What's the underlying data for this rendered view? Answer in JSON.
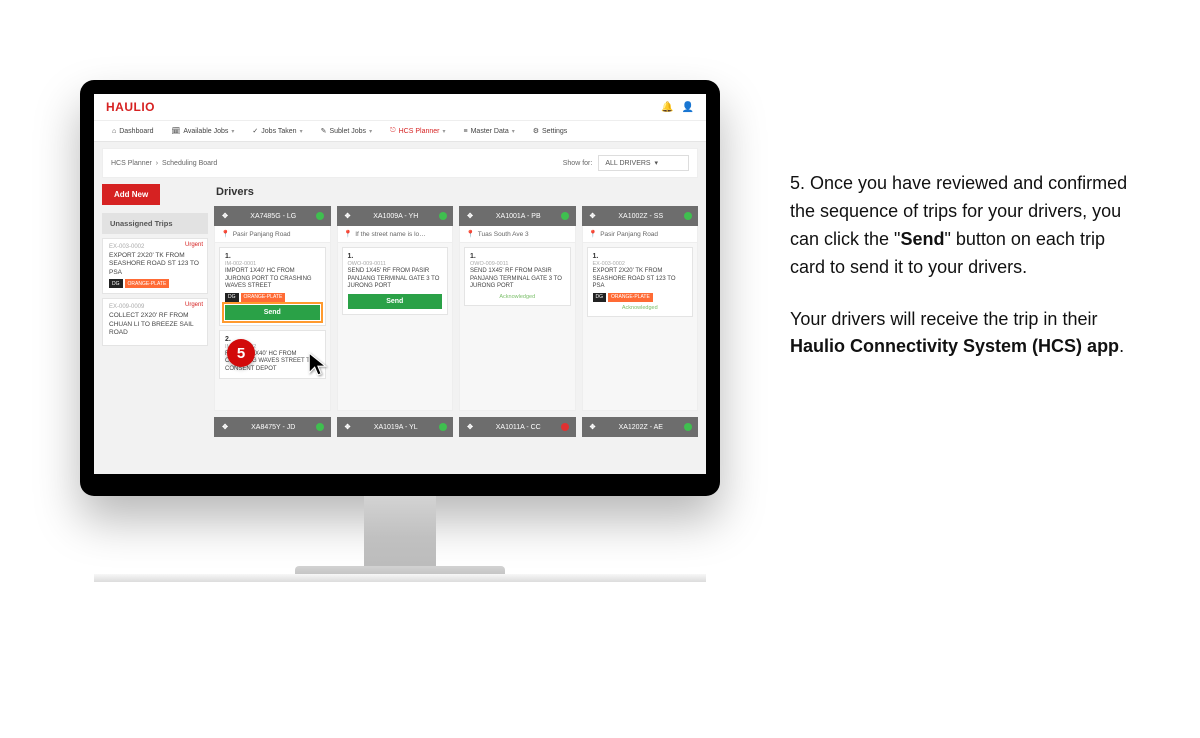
{
  "brand": "HAULIO",
  "nav": {
    "dashboard": "Dashboard",
    "available": "Available Jobs",
    "taken": "Jobs Taken",
    "sublet": "Sublet Jobs",
    "planner": "HCS Planner",
    "master": "Master Data",
    "settings": "Settings"
  },
  "breadcrumb": {
    "a": "HCS Planner",
    "b": "Scheduling Board"
  },
  "showfor": {
    "label": "Show for:",
    "value": "ALL DRIVERS"
  },
  "addnew": "Add New",
  "drivers_title": "Drivers",
  "unassigned": {
    "title": "Unassigned Trips"
  },
  "side_cards": [
    {
      "ref": "EX-003-0002",
      "urgent": "Urgent",
      "desc": "EXPORT 2X20' TK FROM SEASHORE ROAD ST 123 TO PSA",
      "dg": "DG",
      "op": "ORANGE-PLATE"
    },
    {
      "ref": "EX-009-0009",
      "urgent": "Urgent",
      "desc": "COLLECT 2X20' RF FROM CHUAN LI TO BREEZE SAIL ROAD"
    }
  ],
  "columns": [
    {
      "id": "XA7485G - LG",
      "sub": "Pasir Panjang Road",
      "dot": "green",
      "trips": [
        {
          "num": "1.",
          "ref": "IM-002-0001",
          "desc": "IMPORT 1X40' HC FROM JURONG PORT TO CRASHING WAVES STREET",
          "dg": "DG",
          "op": "ORANGE-PLATE",
          "send": "Send",
          "hl": true
        },
        {
          "num": "2.",
          "ref": "IM-002-0002",
          "desc": "RETURN 1X40' HC FROM CRASHING WAVES STREET TO CONSENT DEPOT"
        }
      ]
    },
    {
      "id": "XA1009A - YH",
      "sub": "If the street name is lo…",
      "dot": "green",
      "trips": [
        {
          "num": "1.",
          "ref": "OWO-009-0011",
          "desc": "SEND 1X45' RF FROM PASIR PANJANG TERMINAL GATE 3 TO JURONG PORT",
          "send": "Send"
        }
      ]
    },
    {
      "id": "XA1001A - PB",
      "sub": "Tuas South Ave 3",
      "dot": "green",
      "trips": [
        {
          "num": "1.",
          "ref": "OWO-009-0011",
          "desc": "SEND 1X45' RF FROM PASIR PANJANG TERMINAL GATE 3 TO JURONG PORT",
          "ack": "Acknowledged"
        }
      ]
    },
    {
      "id": "XA1002Z - SS",
      "sub": "Pasir Panjang Road",
      "dot": "green",
      "trips": [
        {
          "num": "1.",
          "ref": "EX-003-0002",
          "desc": "EXPORT 2X20' TK FROM SEASHORE ROAD ST 123 TO PSA",
          "dg": "DG",
          "op": "ORANGE-PLATE",
          "ack": "Acknowledged"
        }
      ]
    }
  ],
  "bottom": [
    {
      "id": "XA8475Y - JD",
      "dot": "green"
    },
    {
      "id": "XA1019A - YL",
      "dot": "green"
    },
    {
      "id": "XA1011A - CC",
      "dot": "red"
    },
    {
      "id": "XA1202Z - AE",
      "dot": "green"
    }
  ],
  "step": {
    "num": "5"
  },
  "instructions": {
    "p1a": "Once you have reviewed and confirmed the sequence of trips for your drivers, you can click the \"",
    "p1b": "Send",
    "p1c": "\" button on each trip card to send it to your drivers.",
    "p2a": "Your drivers will receive the trip in their ",
    "p2b": "Haulio Connectivity System (HCS) app",
    "p2c": "."
  }
}
